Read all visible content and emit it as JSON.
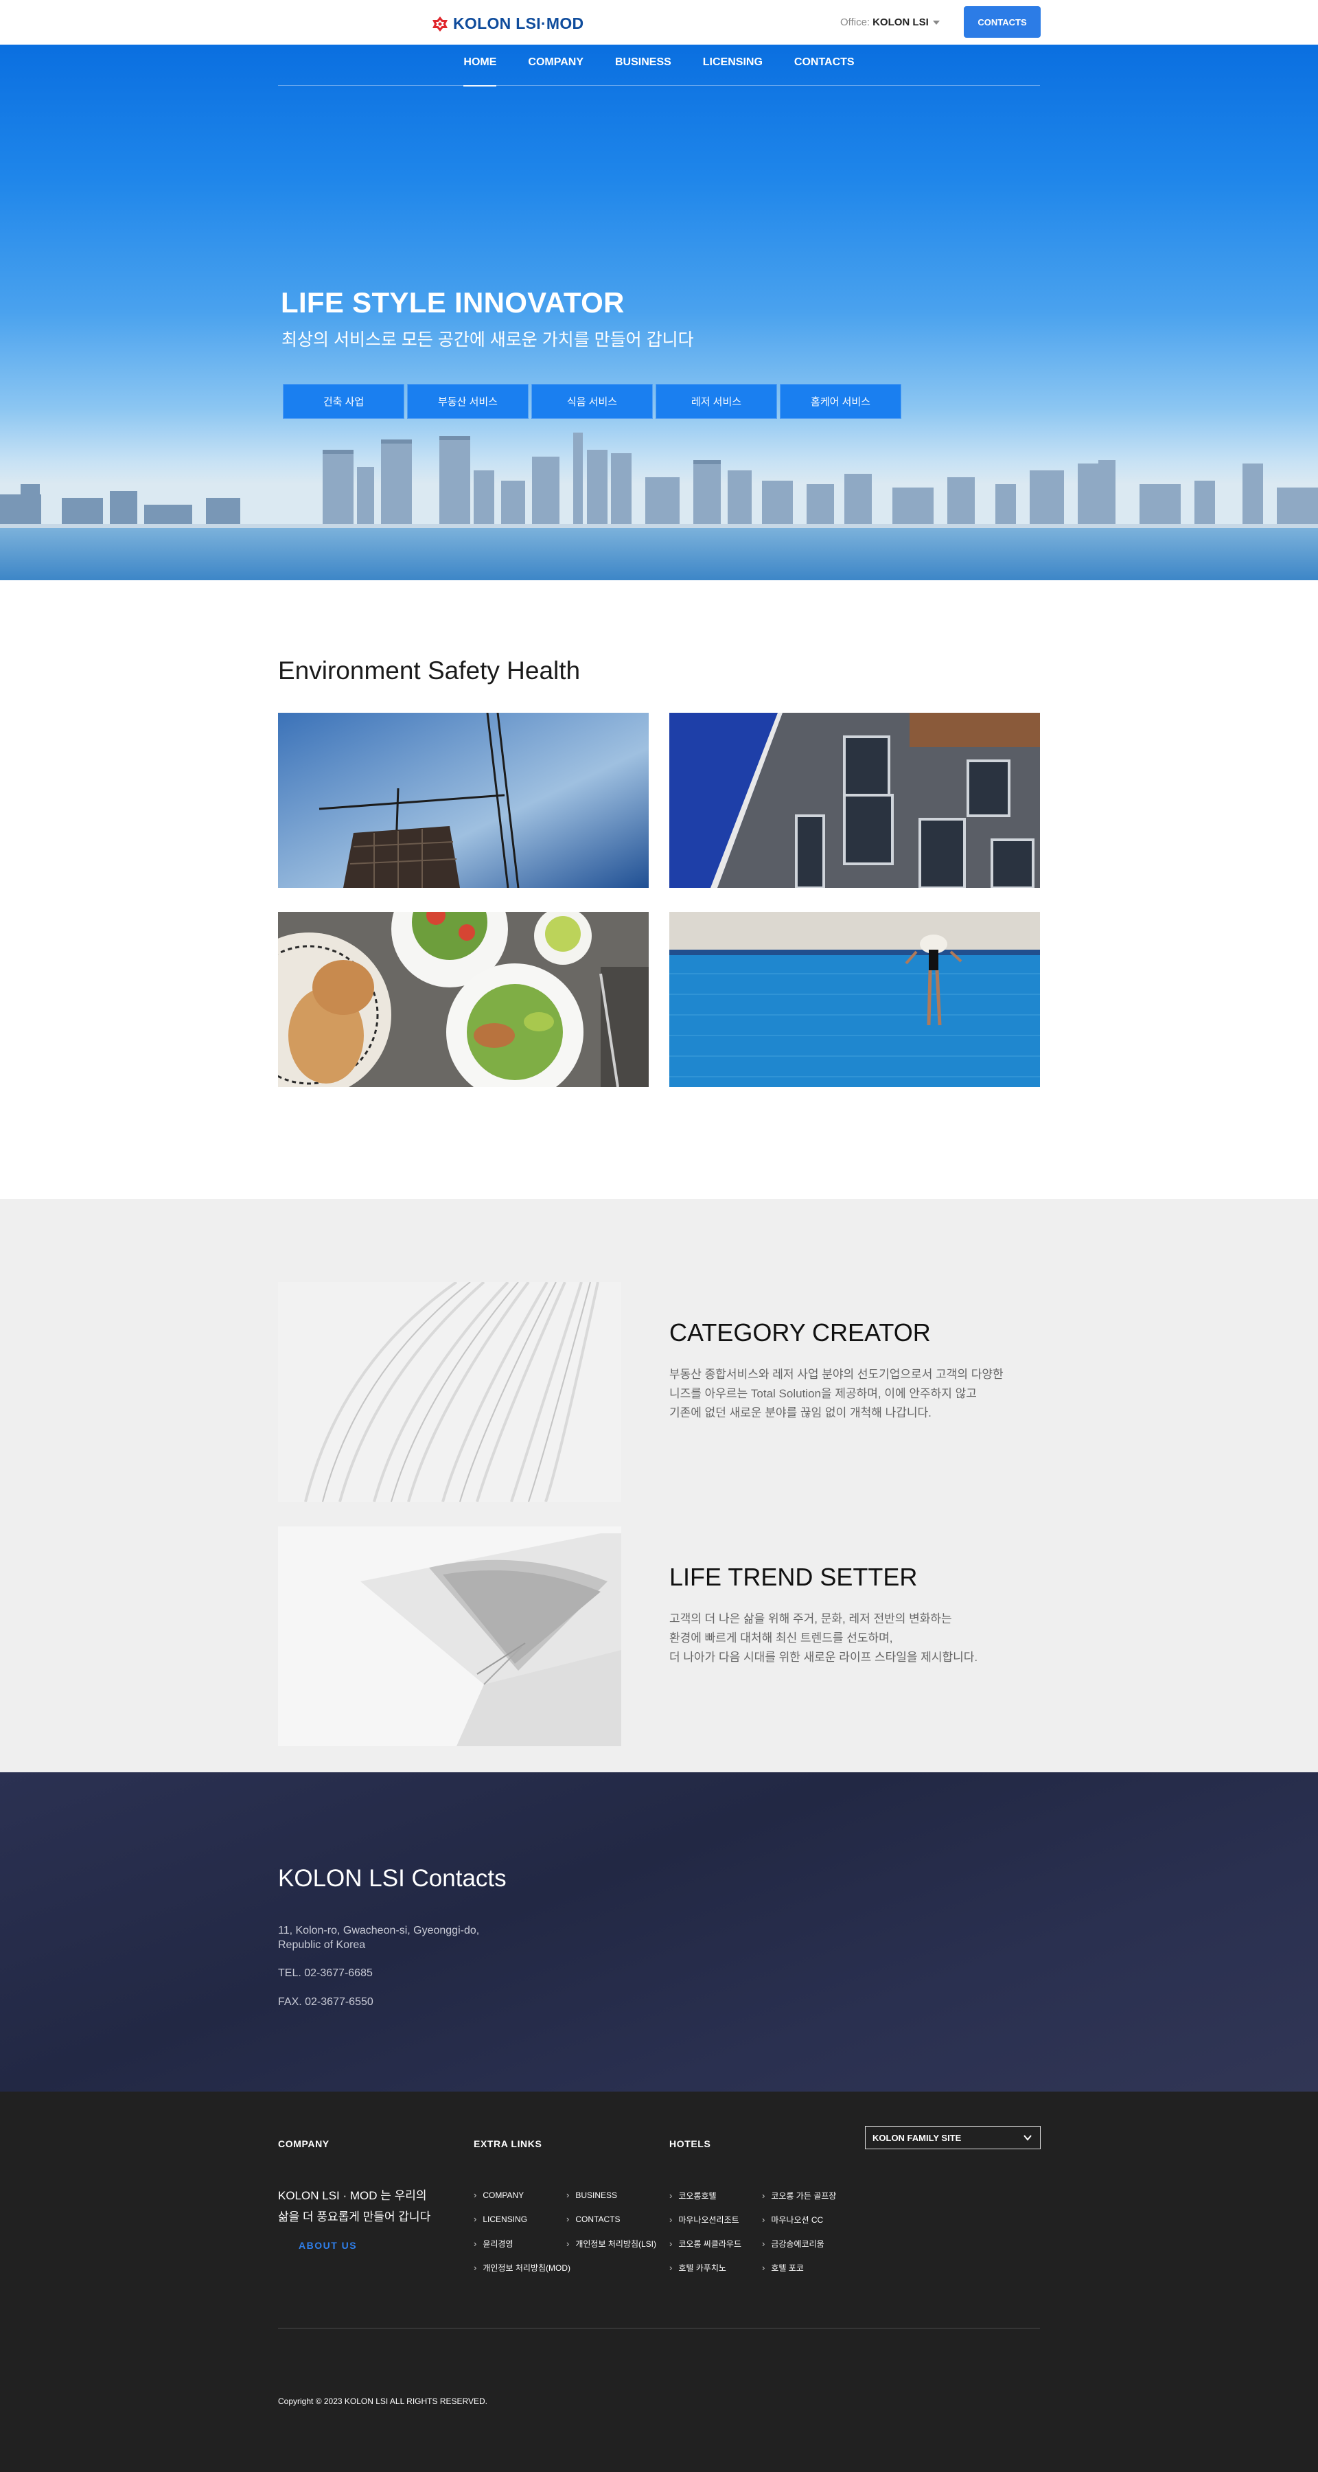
{
  "header": {
    "logo_text": "KOLON LSI·MOD",
    "office_label": "Office:",
    "office_value": "KOLON LSI",
    "contacts_button": "CONTACTS"
  },
  "nav": {
    "items": [
      {
        "label": "HOME",
        "active": true
      },
      {
        "label": "COMPANY"
      },
      {
        "label": "BUSINESS"
      },
      {
        "label": "LICENSING"
      },
      {
        "label": "CONTACTS"
      }
    ]
  },
  "hero": {
    "title": "LIFE STYLE INNOVATOR",
    "subtitle": "최상의 서비스로 모든 공간에 새로운 가치를 만들어 갑니다",
    "buttons": [
      "건축 사업",
      "부동산 서비스",
      "식음 서비스",
      "레저 서비스",
      "홈케어 서비스"
    ]
  },
  "esh": {
    "title": "Environment Safety Health"
  },
  "features": [
    {
      "title": "CATEGORY CREATOR",
      "lines": [
        "부동산 종합서비스와 레저 사업 분야의 선도기업으로서 고객의 다양한",
        "니즈를 아우르는 Total Solution을 제공하며, 이에 안주하지 않고",
        "기존에 없던 새로운 분야를 끊임 없이 개척해 나갑니다."
      ]
    },
    {
      "title": "LIFE TREND SETTER",
      "lines": [
        "고객의 더 나은 삶을 위해 주거, 문화, 레저 전반의 변화하는",
        "환경에 빠르게 대처해 최신 트렌드를 선도하며,",
        "더 나아가 다음 시대를 위한 새로운 라이프 스타일을 제시합니다."
      ]
    }
  ],
  "contacts": {
    "title": "KOLON LSI Contacts",
    "address_line1": "11, Kolon-ro, Gwacheon-si, Gyeonggi-do,",
    "address_line2": "Republic of Korea",
    "tel": "TEL. 02-3677-6685",
    "fax": "FAX. 02-3677-6550"
  },
  "footer": {
    "company_heading": "COMPANY",
    "company_text_line1": "KOLON LSI · MOD 는 우리의",
    "company_text_line2": "삶을 더 풍요롭게 만들어 갑니다",
    "about_link": "ABOUT US",
    "extra_heading": "EXTRA LINKS",
    "extra_links": [
      "COMPANY",
      "BUSINESS",
      "LICENSING",
      "CONTACTS",
      "윤리경영",
      "개인정보 처리방침(LSI)",
      "개인정보 처리방침(MOD)"
    ],
    "hotels_heading": "HOTELS",
    "hotel_links": [
      "코오롱호텔",
      "코오롱 가든 골프장",
      "마우나오션리조트",
      "마우나오션 CC",
      "코오롱 씨클라우드",
      "금강송에코리움",
      "호텔 카푸치노",
      "호텔 포코"
    ],
    "family_site": "KOLON FAMILY SITE",
    "copyright": "Copyright © 2023 KOLON LSI ALL RIGHTS RESERVED."
  },
  "colors": {
    "brand_blue": "#2c7ce6",
    "hero_button": "#1a7ff0",
    "about_link": "#2f80ed",
    "contact_bg": "#262b48",
    "footer_bg": "#212121"
  }
}
